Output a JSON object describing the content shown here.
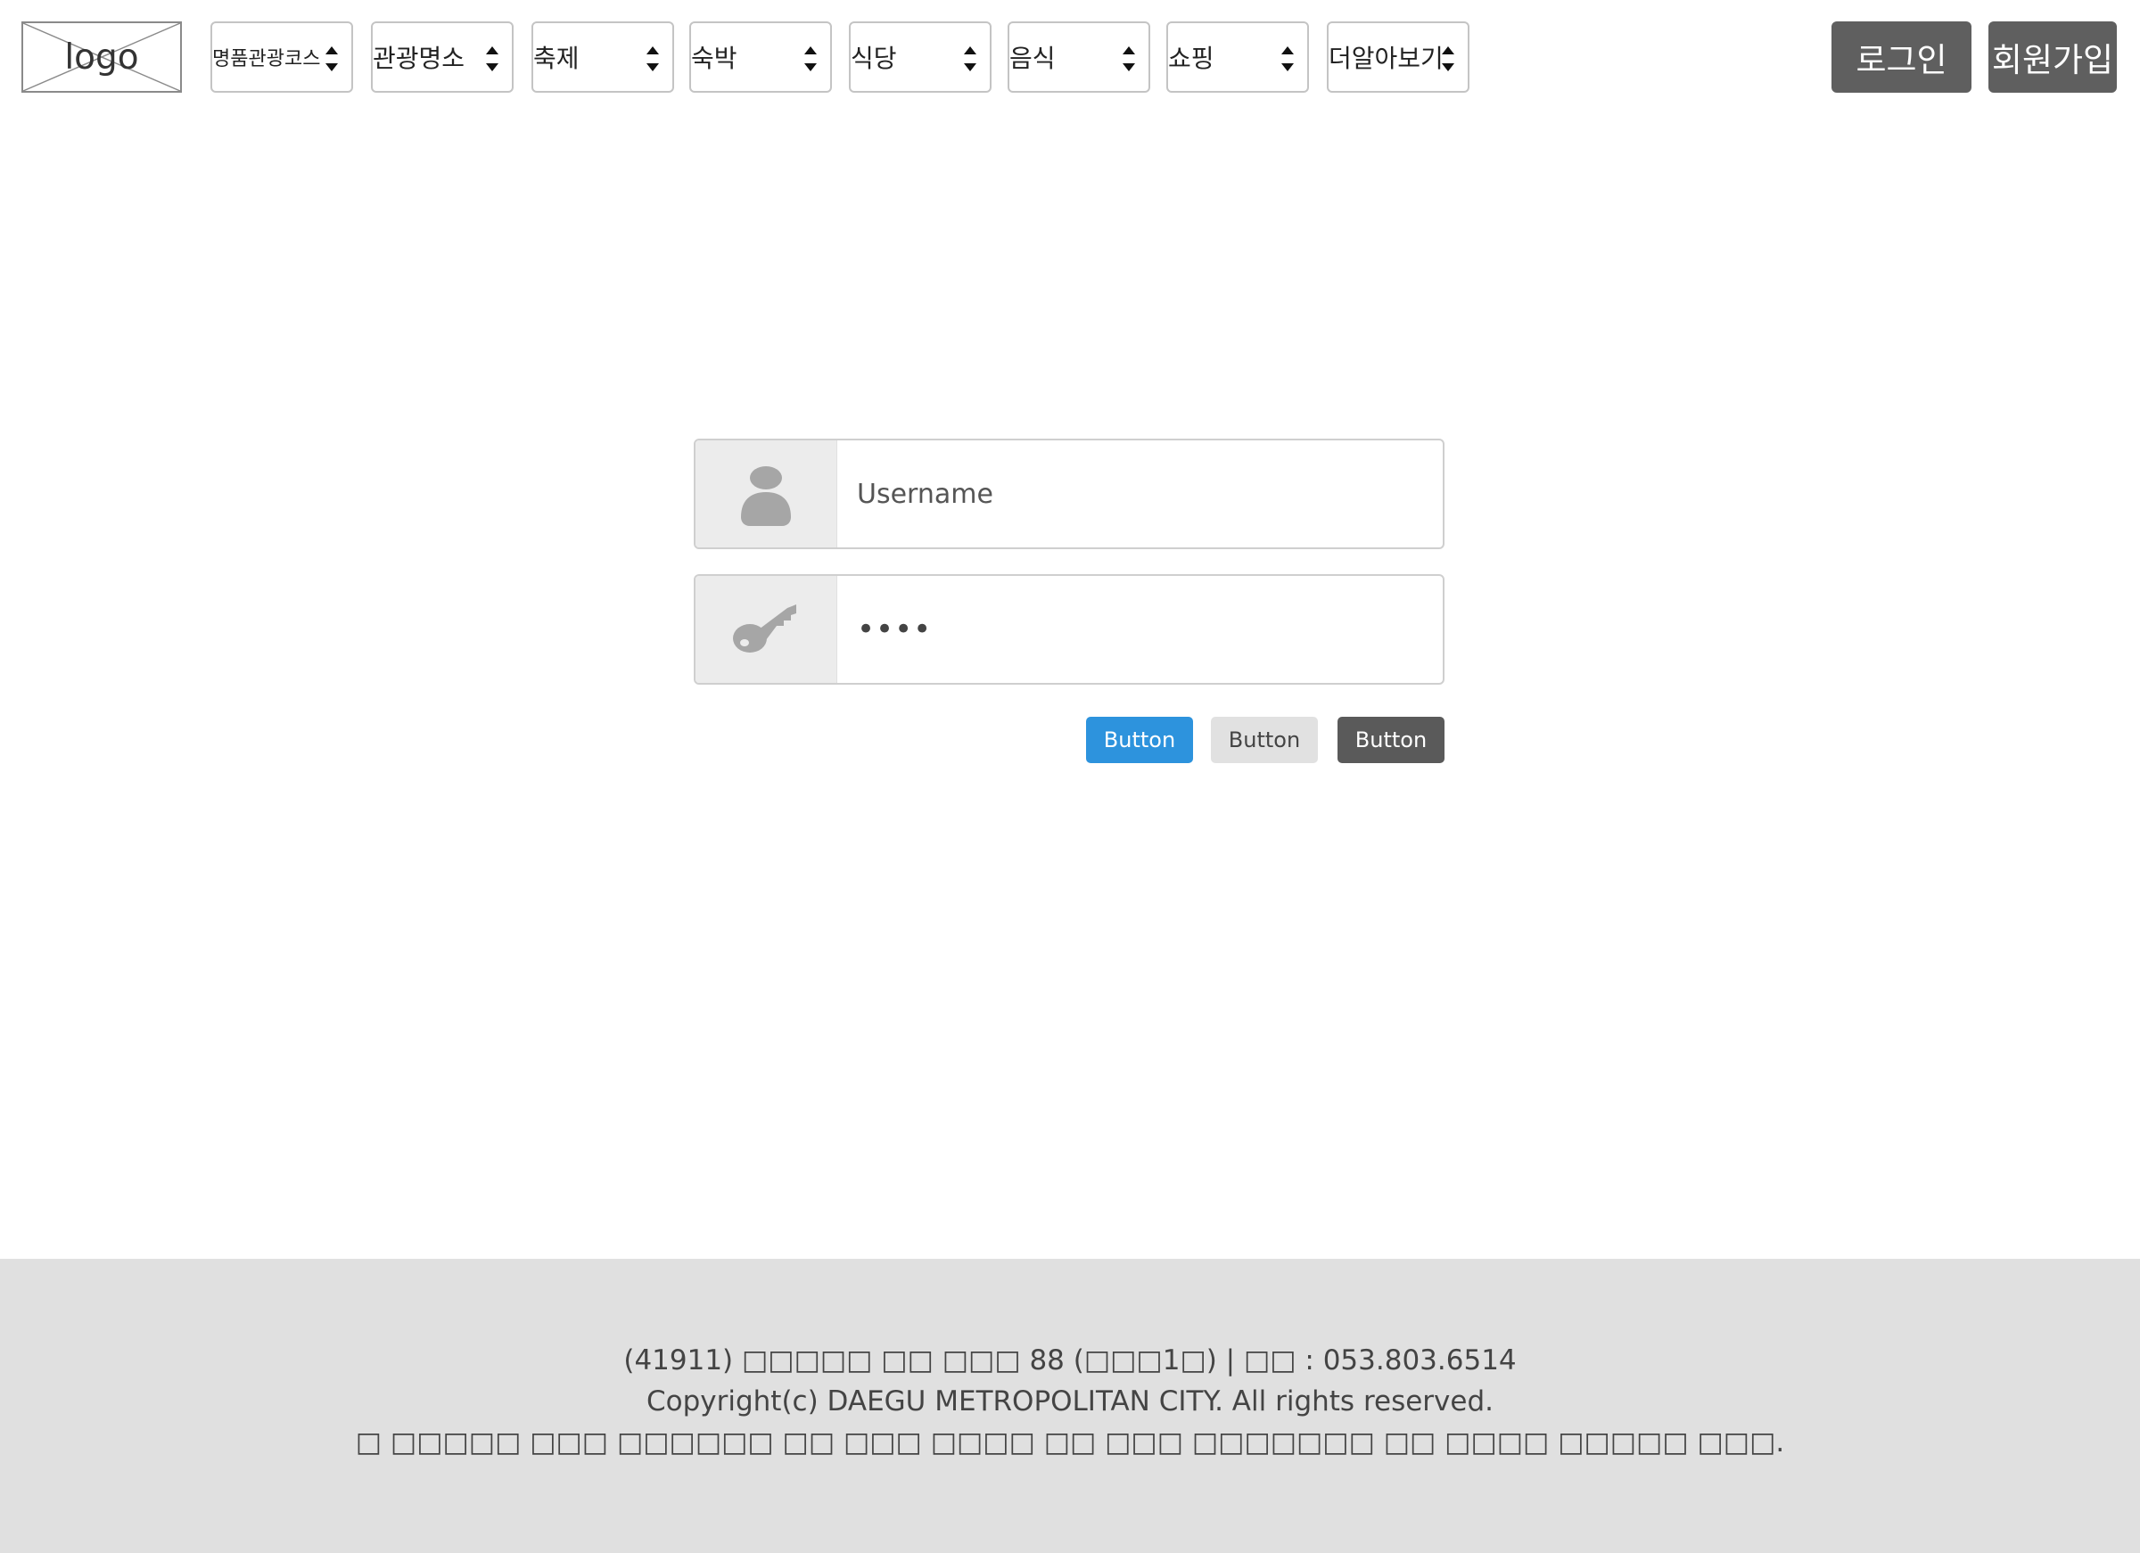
{
  "header": {
    "logo_text": "logo",
    "nav": [
      {
        "label": "명품관광코스"
      },
      {
        "label": "관광명소"
      },
      {
        "label": "축제"
      },
      {
        "label": "숙박"
      },
      {
        "label": "식당"
      },
      {
        "label": "음식"
      },
      {
        "label": "쇼핑"
      },
      {
        "label": "더알아보기"
      }
    ],
    "login_label": "로그인",
    "signup_label": "회원가입"
  },
  "login_form": {
    "username_placeholder": "Username",
    "username_icon": "user-icon",
    "password_value": "••••",
    "password_icon": "key-icon",
    "buttons": [
      {
        "label": "Button",
        "style": "primary",
        "color": "#2d93dd"
      },
      {
        "label": "Button",
        "style": "default",
        "color": "#e1e1e1"
      },
      {
        "label": "Button",
        "style": "dark",
        "color": "#5a5a5a"
      }
    ]
  },
  "footer": {
    "address": "(41911) □□□□□ □□ □□□ 88 (□□□1□) | □□ : 053.803.6514",
    "copyright": "Copyright(c) DAEGU METROPOLITAN CITY. All rights reserved.",
    "notice": "□ □□□□□ □□□ □□□□□□ □□ □□□ □□□□ □□ □□□ □□□□□□□ □□ □□□□ □□□□□ □□□."
  },
  "colors": {
    "header_button_bg": "#5f5f5f",
    "footer_bg": "#e0e0e0",
    "addon_bg": "#ececec"
  }
}
